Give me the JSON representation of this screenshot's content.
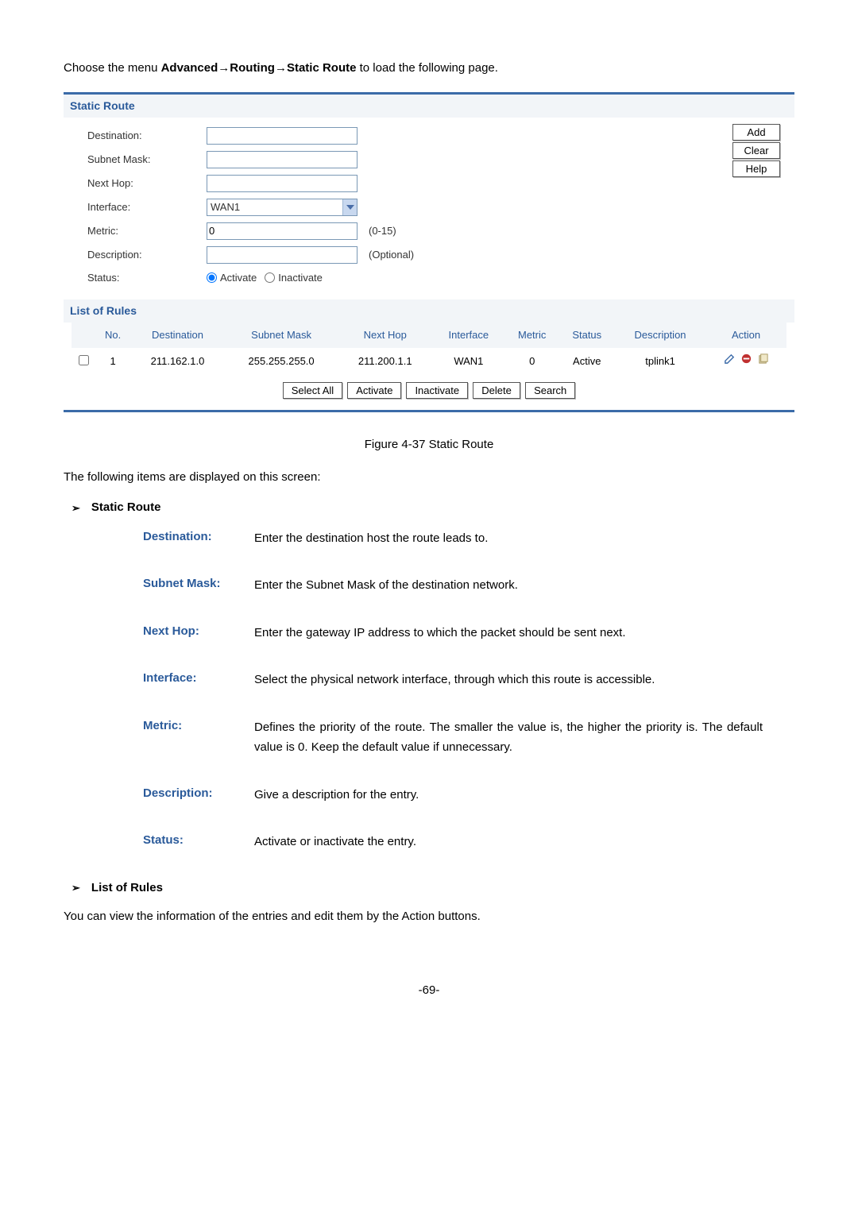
{
  "nav_instruction_prefix": "Choose the menu ",
  "nav_path": [
    "Advanced",
    "Routing",
    "Static Route"
  ],
  "nav_instruction_suffix": " to load the following page.",
  "panel": {
    "section1_title": "Static Route",
    "labels": {
      "destination": "Destination:",
      "subnet_mask": "Subnet Mask:",
      "next_hop": "Next Hop:",
      "interface": "Interface:",
      "metric": "Metric:",
      "description": "Description:",
      "status": "Status:"
    },
    "interface_value": "WAN1",
    "metric_value": "0",
    "metric_hint": "(0-15)",
    "description_hint": "(Optional)",
    "status_activate": "Activate",
    "status_inactivate": "Inactivate",
    "side_buttons": {
      "add": "Add",
      "clear": "Clear",
      "help": "Help"
    },
    "section2_title": "List of Rules",
    "headers": {
      "no": "No.",
      "destination": "Destination",
      "subnet_mask": "Subnet Mask",
      "next_hop": "Next Hop",
      "interface": "Interface",
      "metric": "Metric",
      "status": "Status",
      "description": "Description",
      "action": "Action"
    },
    "rows": [
      {
        "no": "1",
        "destination": "211.162.1.0",
        "subnet_mask": "255.255.255.0",
        "next_hop": "211.200.1.1",
        "interface": "WAN1",
        "metric": "0",
        "status": "Active",
        "description": "tplink1"
      }
    ],
    "bottom_buttons": {
      "select_all": "Select All",
      "activate": "Activate",
      "inactivate": "Inactivate",
      "delete": "Delete",
      "search": "Search"
    }
  },
  "figure_caption": "Figure 4-37 Static Route",
  "items_intro": "The following items are displayed on this screen:",
  "bullet_static_route": "Static Route",
  "definitions": [
    {
      "term": "Destination:",
      "desc": "Enter the destination host the route leads to."
    },
    {
      "term": "Subnet Mask:",
      "desc": "Enter the Subnet Mask of the destination network."
    },
    {
      "term": "Next Hop:",
      "desc": "Enter the gateway IP address to which the packet should be sent next."
    },
    {
      "term": "Interface:",
      "desc": "Select the physical network interface, through which this route is accessible."
    },
    {
      "term": "Metric:",
      "desc": "Defines the priority of the route. The smaller the value is, the higher the priority is. The default value is 0. Keep the default value if unnecessary."
    },
    {
      "term": "Description:",
      "desc": "Give a description for the entry."
    },
    {
      "term": "Status:",
      "desc": "Activate or inactivate the entry."
    }
  ],
  "bullet_list_of_rules": "List of Rules",
  "after_text": "You can view the information of the entries and edit them by the Action buttons.",
  "page_number": "-69-"
}
